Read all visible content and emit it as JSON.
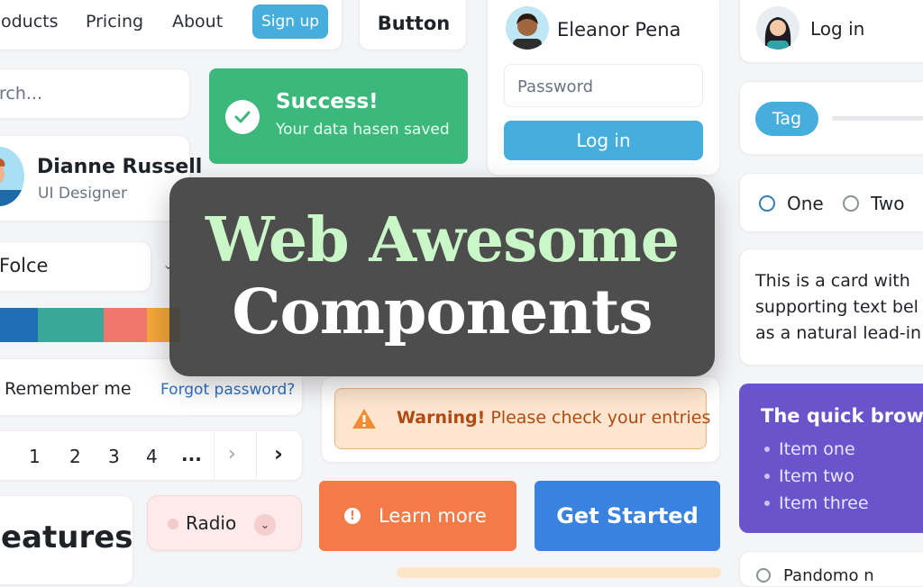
{
  "nav": {
    "products": "oducts",
    "pricing": "Pricing",
    "about": "About",
    "signup": "Sign up"
  },
  "button_demo": {
    "label": "Button"
  },
  "search": {
    "placeholder": "rch..."
  },
  "alert_success": {
    "title": "Success!",
    "text": "Your data hasen saved"
  },
  "login_card": {
    "name": "Eleanor Pena",
    "password_placeholder": "Password",
    "login": "Log in"
  },
  "login_small": {
    "label": "Log in"
  },
  "tag": {
    "label": "Tag"
  },
  "radio_group": {
    "one": "One",
    "two": "Two"
  },
  "profile": {
    "name": "Dianne Russell",
    "role": "UI Designer"
  },
  "select": {
    "value": "Folce"
  },
  "color_swatches": [
    "#1f6fb6",
    "#3aa79b",
    "#f0776c",
    "#f3a63a"
  ],
  "remember": {
    "label": "Remember me",
    "forgot": "Forgot password?"
  },
  "pagination": {
    "pages": [
      "1",
      "2",
      "3",
      "4",
      "..."
    ]
  },
  "features": {
    "title": "eatures"
  },
  "radio_button": {
    "label": "Radio"
  },
  "text_card": {
    "line1": "This is a card with",
    "line2": "supporting text bel",
    "line3": "as a natural lead-in"
  },
  "warning": {
    "strong": "Warning!",
    "text": "Please check your entries"
  },
  "list_card": {
    "title": "The quick brown f",
    "items": [
      "Item one",
      "Item two",
      "Item three"
    ]
  },
  "learn_more": {
    "label": "Learn more"
  },
  "get_started": {
    "label": "Get Started"
  },
  "overlay": {
    "line1": "Web Awesome",
    "line2": "Components"
  },
  "bottom_right": {
    "label": "Pandomo n"
  },
  "colors": {
    "accent_blue": "#46aedd",
    "success_green": "#3db87d",
    "orange": "#f47a47",
    "primary_blue": "#3a82e0",
    "purple": "#6a54cc"
  }
}
